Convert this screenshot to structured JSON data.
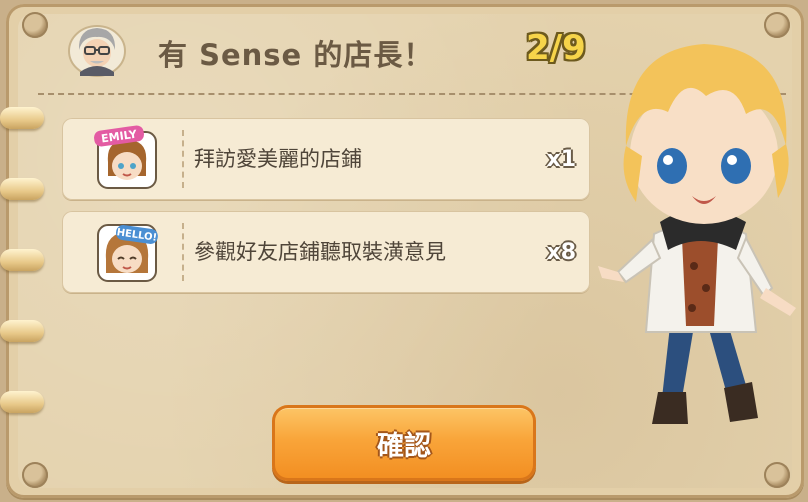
{
  "header": {
    "title": "有 Sense 的店長！",
    "progress": "2/9"
  },
  "tasks": [
    {
      "thumb_label": "EMILY",
      "text": "拜訪愛美麗的店鋪",
      "count": "x1"
    },
    {
      "thumb_label": "HELLO!",
      "text": "參觀好友店鋪聽取裝潢意見",
      "count": "x8"
    }
  ],
  "confirm_button": {
    "label": "確認"
  },
  "colors": {
    "panel": "#e3cfa8",
    "progress": "#f6d44a",
    "button": "#f9a53a"
  },
  "icons": [
    "manager-avatar-icon",
    "emily-avatar-icon",
    "hello-avatar-icon",
    "character-illustration"
  ]
}
